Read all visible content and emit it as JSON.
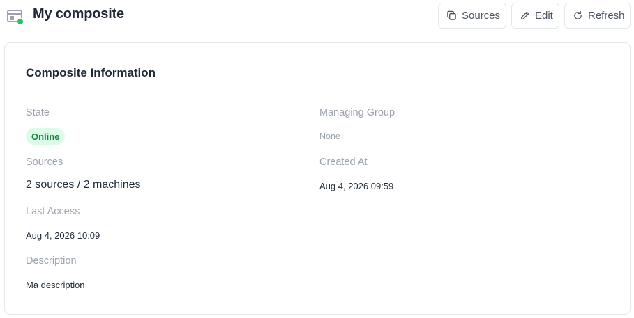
{
  "header": {
    "title": "My composite",
    "icon": "composite-icon",
    "status_color": "#22c55e",
    "buttons": {
      "sources": "Sources",
      "edit": "Edit",
      "refresh": "Refresh"
    }
  },
  "card": {
    "title": "Composite Information",
    "state": {
      "label": "State",
      "value": "Online",
      "color": "#15803d",
      "bg": "#dcfce7"
    },
    "managing_group": {
      "label": "Managing Group",
      "value": "None"
    },
    "sources": {
      "label": "Sources",
      "value": "2 sources / 2 machines"
    },
    "created_at": {
      "label": "Created At",
      "value": "Aug 4, 2026 09:59"
    },
    "last_access": {
      "label": "Last Access",
      "value": "Aug 4, 2026 10:09"
    },
    "description": {
      "label": "Description",
      "value": "Ma description"
    }
  }
}
